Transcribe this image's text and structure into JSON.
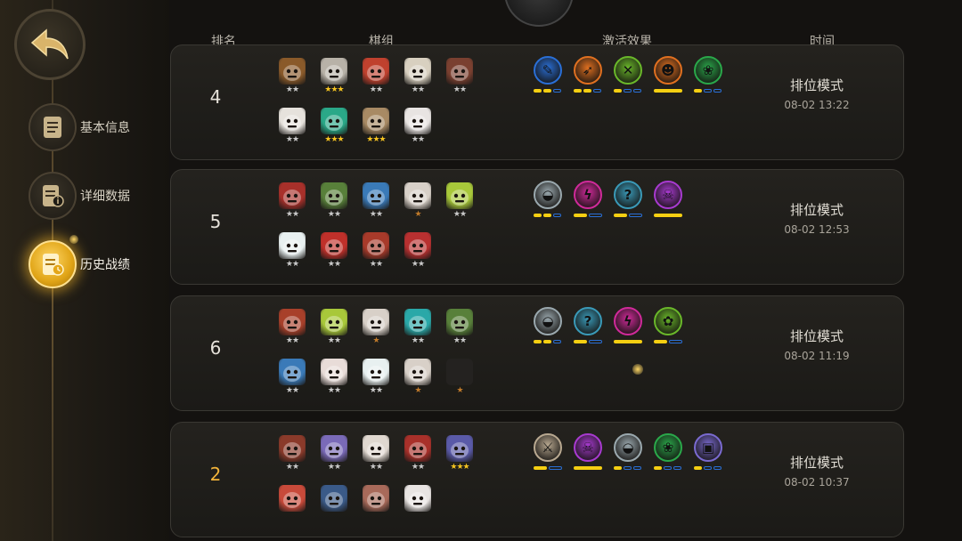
{
  "sidebar": {
    "items": [
      {
        "label": "基本信息",
        "icon": "document-icon",
        "active": false
      },
      {
        "label": "详细数据",
        "icon": "info-document-icon",
        "active": false
      },
      {
        "label": "历史战绩",
        "icon": "history-clock-icon",
        "active": true
      }
    ]
  },
  "header": {
    "rank": "排名",
    "lineup": "棋组",
    "synergies": "激活效果",
    "time": "时间"
  },
  "colors": {
    "accent_gold": "#f2b33a",
    "bar_yellow": "#f5cf12",
    "bar_blue": "#2a6fd6"
  },
  "matches": [
    {
      "rank": "4",
      "mode": "排位模式",
      "time": "08-02 13:22",
      "pieces": [
        {
          "c": "#8a5a2a",
          "stars": "★★",
          "tier": "silver"
        },
        {
          "c": "#b8b2a8",
          "stars": "★★★",
          "tier": "gold"
        },
        {
          "c": "#c0412e",
          "stars": "★★",
          "tier": "silver"
        },
        {
          "c": "#d8d0c0",
          "stars": "★★",
          "tier": "silver"
        },
        {
          "c": "#7a4030",
          "stars": "★★",
          "tier": "silver"
        },
        {
          "c": "#e6e2dc",
          "stars": "★★",
          "tier": "silver"
        },
        {
          "c": "#2aa888",
          "stars": "★★★",
          "tier": "gold"
        },
        {
          "c": "#a88a64",
          "stars": "★★★",
          "tier": "gold"
        },
        {
          "c": "#e8e4e2",
          "stars": "★★",
          "tier": "silver"
        }
      ],
      "synergies": [
        {
          "c": "#2a6fd6",
          "glyph": "✎",
          "name": "feather-icon",
          "bar": [
            1,
            1,
            0
          ]
        },
        {
          "c": "#e07020",
          "glyph": "➶",
          "name": "leaf-icon",
          "bar": [
            1,
            1,
            0
          ]
        },
        {
          "c": "#6ab82a",
          "glyph": "✕",
          "name": "crossed-arrows-icon",
          "bar": [
            1,
            0,
            0
          ]
        },
        {
          "c": "#e07020",
          "glyph": "☻",
          "name": "fox-icon",
          "bar": [
            1
          ]
        },
        {
          "c": "#2aa84a",
          "glyph": "❀",
          "name": "paw-icon",
          "bar": [
            1,
            0,
            0
          ]
        }
      ]
    },
    {
      "rank": "5",
      "mode": "排位模式",
      "time": "08-02 12:53",
      "pieces": [
        {
          "c": "#a8302a",
          "stars": "★★",
          "tier": "silver"
        },
        {
          "c": "#58803a",
          "stars": "★★",
          "tier": "silver"
        },
        {
          "c": "#3a7ab8",
          "stars": "★★",
          "tier": "silver"
        },
        {
          "c": "#d8d0c8",
          "stars": "★",
          "tier": "bronze"
        },
        {
          "c": "#a8c83a",
          "stars": "★★",
          "tier": "silver"
        },
        {
          "c": "#e8f0f0",
          "stars": "★★",
          "tier": "silver"
        },
        {
          "c": "#c0302a",
          "stars": "★★",
          "tier": "silver"
        },
        {
          "c": "#a83a2a",
          "stars": "★★",
          "tier": "silver"
        },
        {
          "c": "#b83030",
          "stars": "★★",
          "tier": "silver"
        }
      ],
      "synergies": [
        {
          "c": "#9aa8ae",
          "glyph": "◒",
          "name": "helmet-icon",
          "bar": [
            1,
            1,
            0
          ]
        },
        {
          "c": "#d02a9a",
          "glyph": "ϟ",
          "name": "lightning-icon",
          "bar": [
            1,
            0
          ]
        },
        {
          "c": "#3a9ab8",
          "glyph": "?",
          "name": "mystery-icon",
          "bar": [
            1,
            0
          ]
        },
        {
          "c": "#a83ad0",
          "glyph": "☠",
          "name": "demon-icon",
          "bar": [
            1
          ]
        }
      ]
    },
    {
      "rank": "6",
      "mode": "排位模式",
      "time": "08-02 11:19",
      "pieces": [
        {
          "c": "#a8402a",
          "stars": "★★",
          "tier": "silver"
        },
        {
          "c": "#a8c83a",
          "stars": "★★",
          "tier": "silver"
        },
        {
          "c": "#d8d0c8",
          "stars": "★",
          "tier": "bronze"
        },
        {
          "c": "#2aa8a8",
          "stars": "★★",
          "tier": "silver"
        },
        {
          "c": "#58803a",
          "stars": "★★",
          "tier": "silver"
        },
        {
          "c": "#3a7ab8",
          "stars": "★★",
          "tier": "silver"
        },
        {
          "c": "#e8dcd8",
          "stars": "★★",
          "tier": "silver"
        },
        {
          "c": "#e8f0f0",
          "stars": "★★",
          "tier": "silver"
        },
        {
          "c": "#d8d0c8",
          "stars": "★",
          "tier": "bronze"
        },
        {
          "c": "#242220",
          "stars": "★",
          "tier": "bronze"
        }
      ],
      "synergies": [
        {
          "c": "#9aa8ae",
          "glyph": "◒",
          "name": "helmet-icon",
          "bar": [
            1,
            1,
            0
          ]
        },
        {
          "c": "#3a9ab8",
          "glyph": "?",
          "name": "mystery-icon",
          "bar": [
            1,
            0
          ]
        },
        {
          "c": "#d02a9a",
          "glyph": "ϟ",
          "name": "lightning-icon",
          "bar": [
            1
          ]
        },
        {
          "c": "#6ab82a",
          "glyph": "✿",
          "name": "nature-icon",
          "bar": [
            1,
            0
          ]
        }
      ]
    },
    {
      "rank": "2",
      "mode": "排位模式",
      "time": "08-02 10:37",
      "pieces": [
        {
          "c": "#8a3a2a",
          "stars": "★★",
          "tier": "silver"
        },
        {
          "c": "#7a6ab8",
          "stars": "★★",
          "tier": "silver"
        },
        {
          "c": "#e0d8d0",
          "stars": "★★",
          "tier": "silver"
        },
        {
          "c": "#a8302a",
          "stars": "★★",
          "tier": "silver"
        },
        {
          "c": "#5a5aa8",
          "stars": "★★★",
          "tier": "gold"
        },
        {
          "c": "#c84a3a",
          "stars": "",
          "tier": "silver"
        },
        {
          "c": "#3a5a88",
          "stars": "",
          "tier": "silver"
        },
        {
          "c": "#a86a5a",
          "stars": "",
          "tier": "silver"
        },
        {
          "c": "#e8e4e2",
          "stars": "",
          "tier": "silver"
        }
      ],
      "synergies": [
        {
          "c": "#b8a890",
          "glyph": "⚔",
          "name": "axe-icon",
          "bar": [
            1,
            0
          ]
        },
        {
          "c": "#a83ad0",
          "glyph": "☠",
          "name": "demon-icon",
          "bar": [
            1
          ]
        },
        {
          "c": "#9aa8ae",
          "glyph": "◒",
          "name": "helmet-icon",
          "bar": [
            1,
            0,
            0
          ]
        },
        {
          "c": "#2aa84a",
          "glyph": "❀",
          "name": "paw-icon",
          "bar": [
            1,
            0,
            0
          ]
        },
        {
          "c": "#7a6ad0",
          "glyph": "▣",
          "name": "machine-icon",
          "bar": [
            1,
            0,
            0
          ]
        }
      ]
    }
  ]
}
